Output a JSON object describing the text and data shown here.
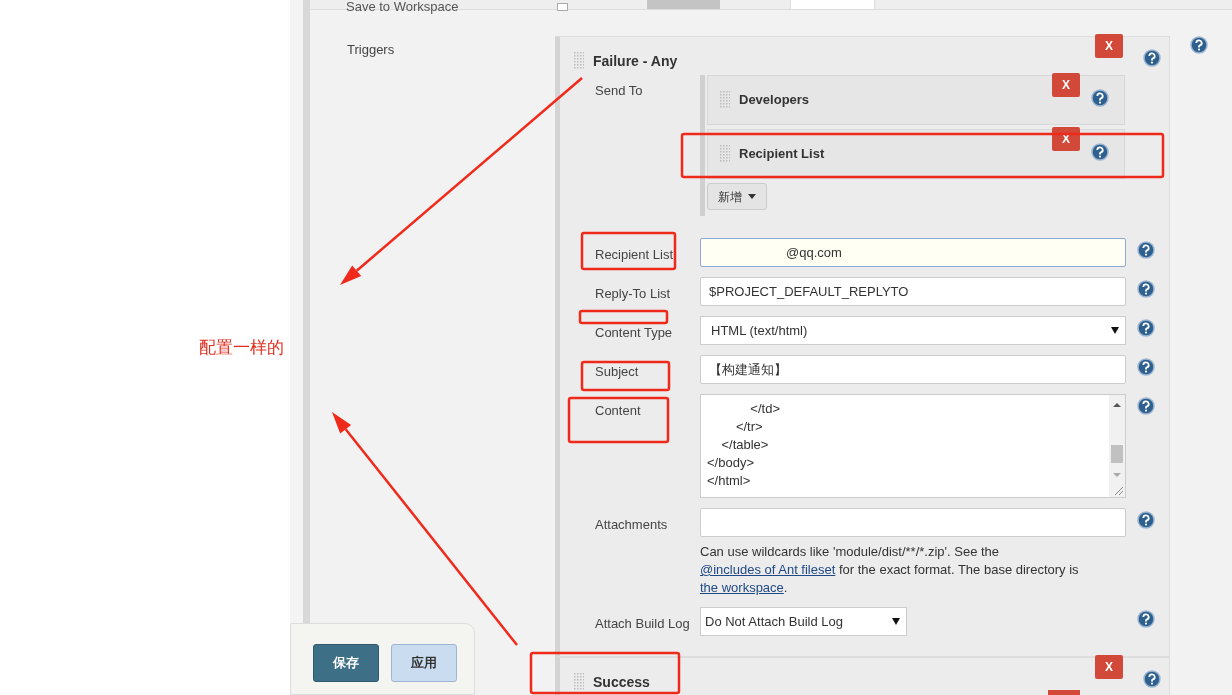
{
  "top_section": {
    "label": "Save to Workspace",
    "checked": false
  },
  "triggers": {
    "label": "Triggers",
    "trigger_list": [
      {
        "title": "Failure - Any",
        "remove_label": "X",
        "send_to": {
          "label": "Send To",
          "recipients": [
            {
              "title": "Developers",
              "remove_label": "X"
            },
            {
              "title": "Recipient List",
              "remove_label": "X"
            }
          ],
          "add_button": "新增"
        },
        "fields": [
          {
            "kind": "input",
            "label": "Recipient List",
            "value": "@qq.com",
            "focused": true
          },
          {
            "kind": "input",
            "label": "Reply-To List",
            "value": "$PROJECT_DEFAULT_REPLYTO",
            "focused": false
          },
          {
            "kind": "select",
            "label": "Content Type",
            "value": "HTML (text/html)"
          },
          {
            "kind": "input",
            "label": "Subject",
            "value": "【构建通知】",
            "focused": false
          },
          {
            "kind": "textarea",
            "label": "Content",
            "lines": [
              "            </td>",
              "        </tr>",
              "    </table>",
              "</body>",
              "</html>"
            ]
          },
          {
            "kind": "input",
            "label": "Attachments",
            "focused": false
          },
          {
            "kind": "note",
            "parts": [
              {
                "kind": "text",
                "text": "Can use wildcards like 'module/dist/**/*.zip'. See the "
              },
              {
                "kind": "link",
                "text": "@includes of Ant fileset"
              },
              {
                "kind": "text",
                "text": " for the exact format. The base directory is "
              },
              {
                "kind": "link",
                "text": "the workspace"
              },
              {
                "kind": "text",
                "text": "."
              }
            ]
          },
          {
            "kind": "select_small",
            "label": "Attach Build Log",
            "value": "Do Not Attach Build Log"
          }
        ]
      },
      {
        "title": "Success",
        "remove_label": "X"
      }
    ]
  },
  "annotation": "配置一样的",
  "footer_buttons": [
    {
      "label": "保存",
      "kind": "primary"
    },
    {
      "label": "应用",
      "kind": "secondary"
    }
  ]
}
